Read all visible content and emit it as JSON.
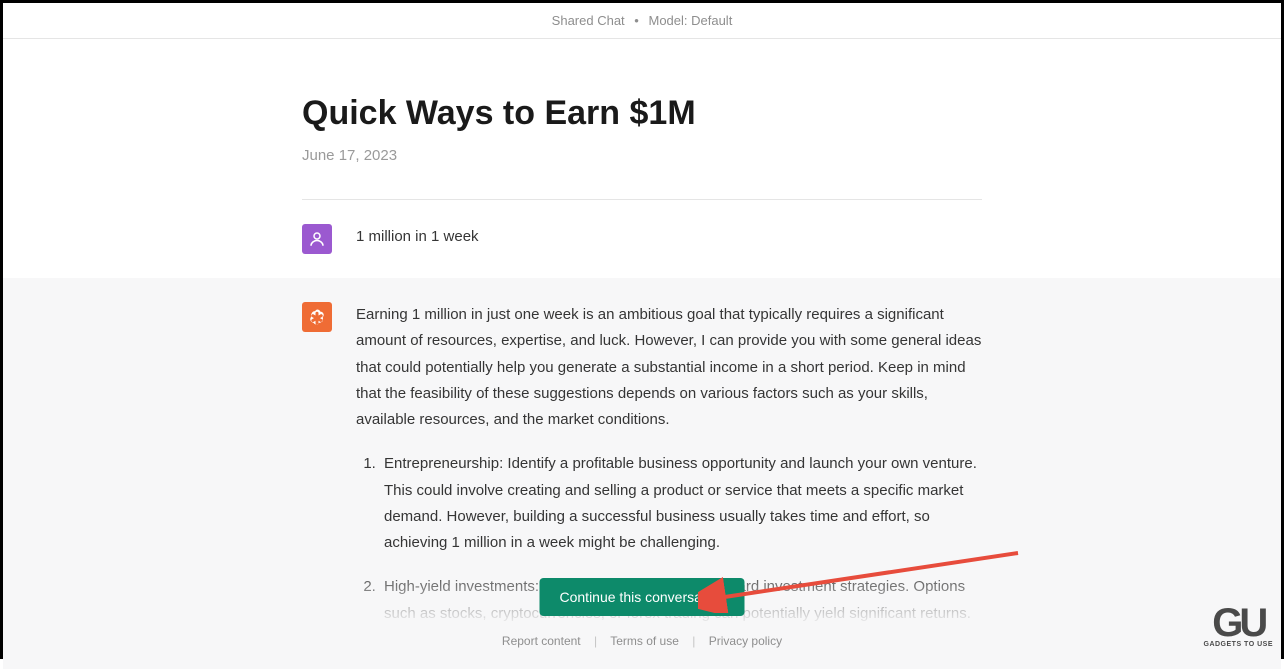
{
  "header": {
    "shared_label": "Shared Chat",
    "model_label": "Model: Default"
  },
  "title": {
    "heading": "Quick Ways to Earn $1M",
    "date": "June 17, 2023"
  },
  "user_message": {
    "text": "1 million in 1 week"
  },
  "assistant_message": {
    "intro": "Earning 1 million in just one week is an ambitious goal that typically requires a significant amount of resources, expertise, and luck. However, I can provide you with some general ideas that could potentially help you generate a substantial income in a short period. Keep in mind that the feasibility of these suggestions depends on various factors such as your skills, available resources, and the market conditions.",
    "list_item_1": "Entrepreneurship: Identify a profitable business opportunity and launch your own venture. This could involve creating and selling a product or service that meets a specific market demand. However, building a successful business usually takes time and effort, so achieving 1 million in a week might be challenging.",
    "list_item_2": "High-yield investments: Engage in high-risk, high-reward investment strategies. Options such as stocks, cryptocurrencies, or forex trading can potentially yield significant returns."
  },
  "continue_button": {
    "label": "Continue this conversation"
  },
  "footer": {
    "report": "Report content",
    "terms": "Terms of use",
    "privacy": "Privacy policy"
  },
  "watermark": {
    "logo": "GU",
    "text": "GADGETS TO USE"
  }
}
